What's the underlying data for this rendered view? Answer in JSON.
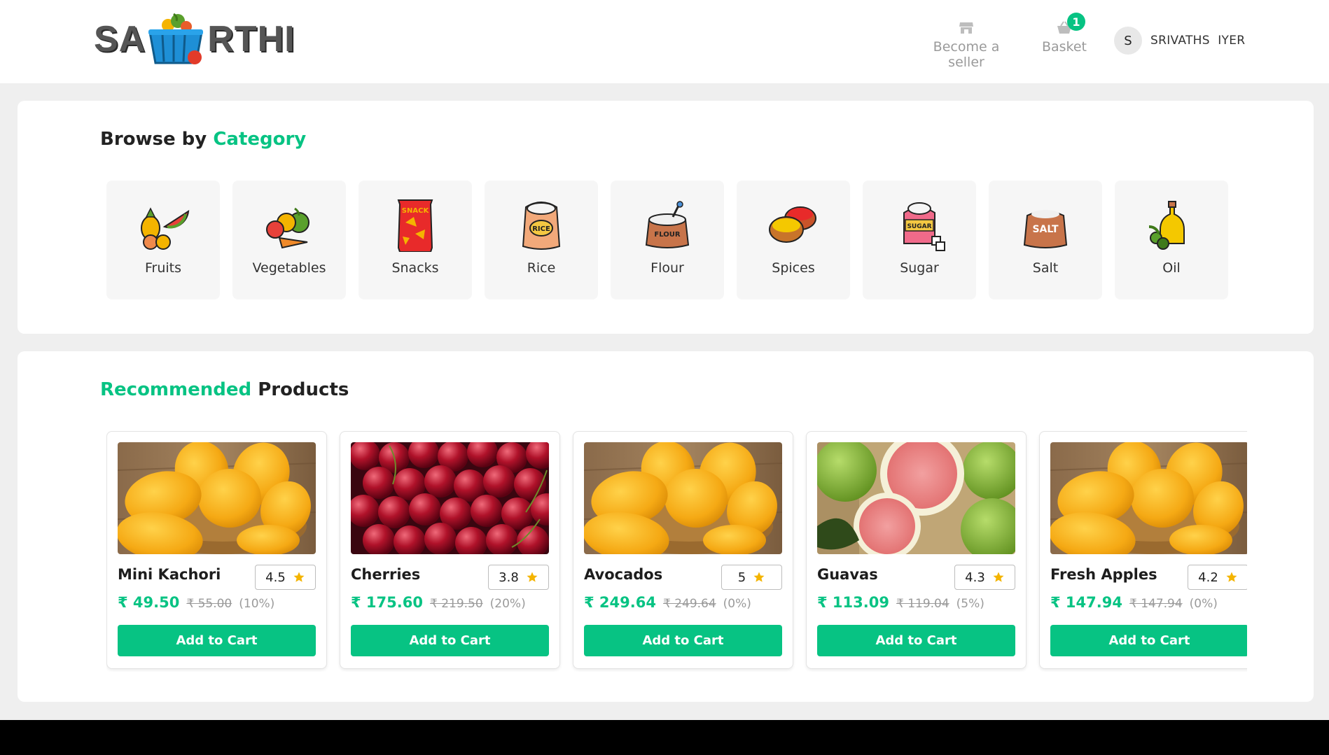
{
  "brand": {
    "logo_left": "SA",
    "logo_right": "RTHI"
  },
  "header": {
    "seller_label": "Become a seller",
    "basket_label": "Basket",
    "basket_count": "1",
    "user_initial": "S",
    "user_name": "SRIVATHS  IYER",
    "icons": [
      "store-icon",
      "basket-icon"
    ]
  },
  "categories": {
    "title_prefix": "Browse by",
    "title_highlight": "Category",
    "items": [
      {
        "label": "Fruits",
        "icon": "fruits-icon"
      },
      {
        "label": "Vegetables",
        "icon": "vegetables-icon"
      },
      {
        "label": "Snacks",
        "icon": "snacks-icon"
      },
      {
        "label": "Rice",
        "icon": "rice-icon"
      },
      {
        "label": "Flour",
        "icon": "flour-icon"
      },
      {
        "label": "Spices",
        "icon": "spices-icon"
      },
      {
        "label": "Sugar",
        "icon": "sugar-icon"
      },
      {
        "label": "Salt",
        "icon": "salt-icon"
      },
      {
        "label": "Oil",
        "icon": "oil-icon"
      }
    ],
    "icon_text": {
      "snack": "SNACK",
      "rice": "RICE",
      "flour": "FLOUR",
      "sugar": "SUGAR",
      "salt": "SALT"
    }
  },
  "recommended": {
    "title_highlight": "Recommended",
    "title_suffix": "Products",
    "button_label": "Add to Cart",
    "products": [
      {
        "name": "Mini Kachori",
        "rating": "4.5",
        "price": "₹ 49.50",
        "mrp": "₹ 55.00",
        "discount": "(10%)",
        "image": "mango"
      },
      {
        "name": "Cherries",
        "rating": "3.8",
        "price": "₹ 175.60",
        "mrp": "₹ 219.50",
        "discount": "(20%)",
        "image": "cherries"
      },
      {
        "name": "Avocados",
        "rating": "5",
        "price": "₹ 249.64",
        "mrp": "₹ 249.64",
        "discount": "(0%)",
        "image": "mango"
      },
      {
        "name": "Guavas",
        "rating": "4.3",
        "price": "₹ 113.09",
        "mrp": "₹ 119.04",
        "discount": "(5%)",
        "image": "guava"
      },
      {
        "name": "Fresh Apples",
        "rating": "4.2",
        "price": "₹ 147.94",
        "mrp": "₹ 147.94",
        "discount": "(0%)",
        "image": "mango"
      }
    ]
  },
  "colors": {
    "accent": "#07c383",
    "star": "#f4b400",
    "panel_bg": "#ffffff",
    "page_bg": "#efefef"
  }
}
